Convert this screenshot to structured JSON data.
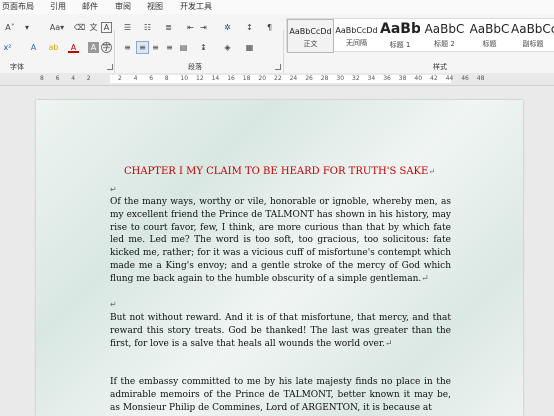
{
  "ribbon": {
    "tabs": [
      "页面布局",
      "引用",
      "邮件",
      "审阅",
      "视图",
      "开发工具"
    ],
    "groups": {
      "font": "字体",
      "paragraph": "段落",
      "styles": "样式"
    },
    "styles": [
      {
        "sample": "AaBbCcDd",
        "name": "正文"
      },
      {
        "sample": "AaBbCcDd",
        "name": "无间隔"
      },
      {
        "sample": "AaBb",
        "name": "标题 1"
      },
      {
        "sample": "AaBbC",
        "name": "标题 2"
      },
      {
        "sample": "AaBbC",
        "name": "标题"
      },
      {
        "sample": "AaBbCc",
        "name": "副标题"
      }
    ]
  },
  "ruler": {
    "ticks": [
      "8",
      "6",
      "4",
      "2",
      "",
      "2",
      "4",
      "6",
      "8",
      "10",
      "12",
      "14",
      "16",
      "18",
      "20",
      "22",
      "24",
      "26",
      "28",
      "30",
      "32",
      "34",
      "36",
      "38",
      "40",
      "42",
      "44",
      "46",
      "48"
    ]
  },
  "document": {
    "heading": "CHAPTER I MY CLAIM TO BE HEARD FOR TRUTH'S SAKE",
    "paragraphs": [
      "Of the many ways, worthy or vile, honorable or ignoble, whereby men, as my excellent friend the Prince de TALMONT has shown in his history, may rise to court favor, few, I think, are more curious than that by which fate led me. Led me? The word is too soft, too gracious, too solicitous: fate kicked me, rather; for it was a vicious cuff of misfortune's contempt which made me a King's envoy; and a gentle stroke of the mercy of God which flung me back again to the humble obscurity of a simple gentleman.",
      "But not without reward. And it is of that misfortune, that mercy, and that reward this story treats. God be thanked! The last was greater than the first, for love is a salve that heals all wounds the world over.",
      "If the embassy committed to me by his late majesty finds no place in the admirable memoirs of the Prince de TALMONT, better known it may be, as Monsieur Philip de Commines, Lord of ARGENTON, it is because at"
    ]
  }
}
